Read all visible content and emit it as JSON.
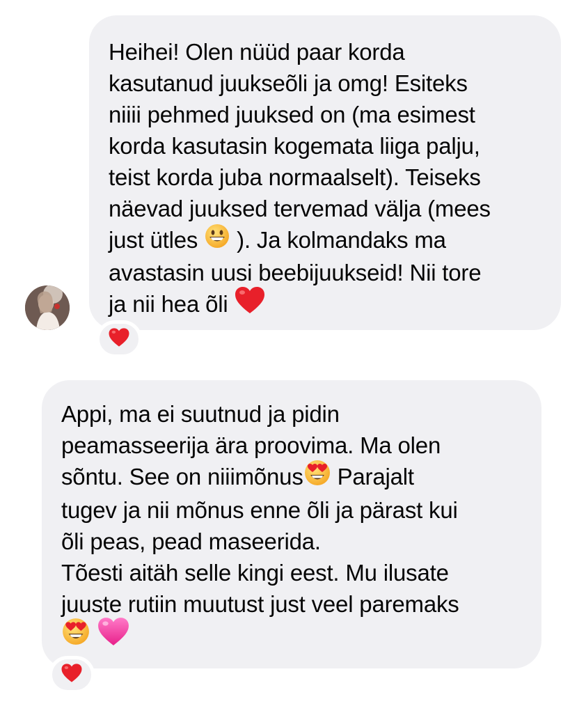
{
  "colors": {
    "bubble_bg": "#f0f0f3",
    "heart_red": "#e8202a",
    "heart_pink": "#ff3fa4",
    "emoji_yellow": "#ffcc33"
  },
  "messages": [
    {
      "lines": [
        "Heihei! Olen nüüd paar korda",
        "kasutanud juukseõli ja omg! Esiteks",
        "niiii pehmed juuksed on (ma esimest",
        "korda kasutasin kogemata liiga palju,",
        "teist korda juba normaalselt). Teiseks",
        "näevad juuksed tervemad välja (mees",
        "just ütles",
        "). Ja kolmandaks ma",
        "avastasin uusi beebijuukseid! Nii tore",
        "ja nii hea õli"
      ],
      "inline_icons": [
        "grinning-face-emoji",
        "red-heart-emoji"
      ],
      "reaction": "red-heart-emoji"
    },
    {
      "lines": [
        "Appi, ma ei suutnud ja pidin",
        "peamasseerija ära proovima. Ma olen",
        "sõntu. See on niiimõnus",
        "Parajalt",
        "tugev ja nii mõnus enne õli ja pärast kui",
        "õli peas, pead maseerida.",
        "Tõesti aitäh selle kingi eest. Mu ilusate",
        "juuste rutiin muutust just veel paremaks"
      ],
      "inline_icons": [
        "heart-eyes-emoji",
        "heart-eyes-emoji",
        "pink-heart-emoji"
      ],
      "reaction": "red-heart-emoji"
    }
  ]
}
